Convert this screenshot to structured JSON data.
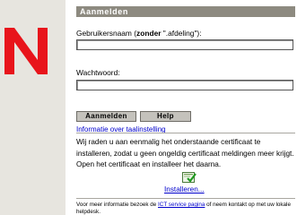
{
  "login": {
    "header": "Aanmelden",
    "username_label_prefix": "Gebruikersnaam (",
    "username_label_bold": "zonder",
    "username_label_suffix": " \".afdeling\"):",
    "username_value": "",
    "password_label": "Wachtwoord:",
    "password_value": "",
    "login_button": "Aanmelden",
    "help_button": "Help",
    "language_link": "Informatie over taalinstelling"
  },
  "certificate": {
    "notice": "Wij raden u aan eenmalig het onderstaande certificaat te installeren, zodat u geen ongeldig certificaat meldingen meer krijgt. Open het certificaat en installeer het daarna.",
    "install_link": "Installeren..."
  },
  "footer": {
    "text_before": "Voor meer informatie bezoek de ",
    "link": "ICT service pagina",
    "text_after": " of neem kontakt op met uw lokale helpdesk."
  },
  "colors": {
    "logo_red": "#e8141b",
    "header_bg": "#8d8a80",
    "sidebar_bg": "#e7e5df",
    "link": "#0000cc"
  }
}
